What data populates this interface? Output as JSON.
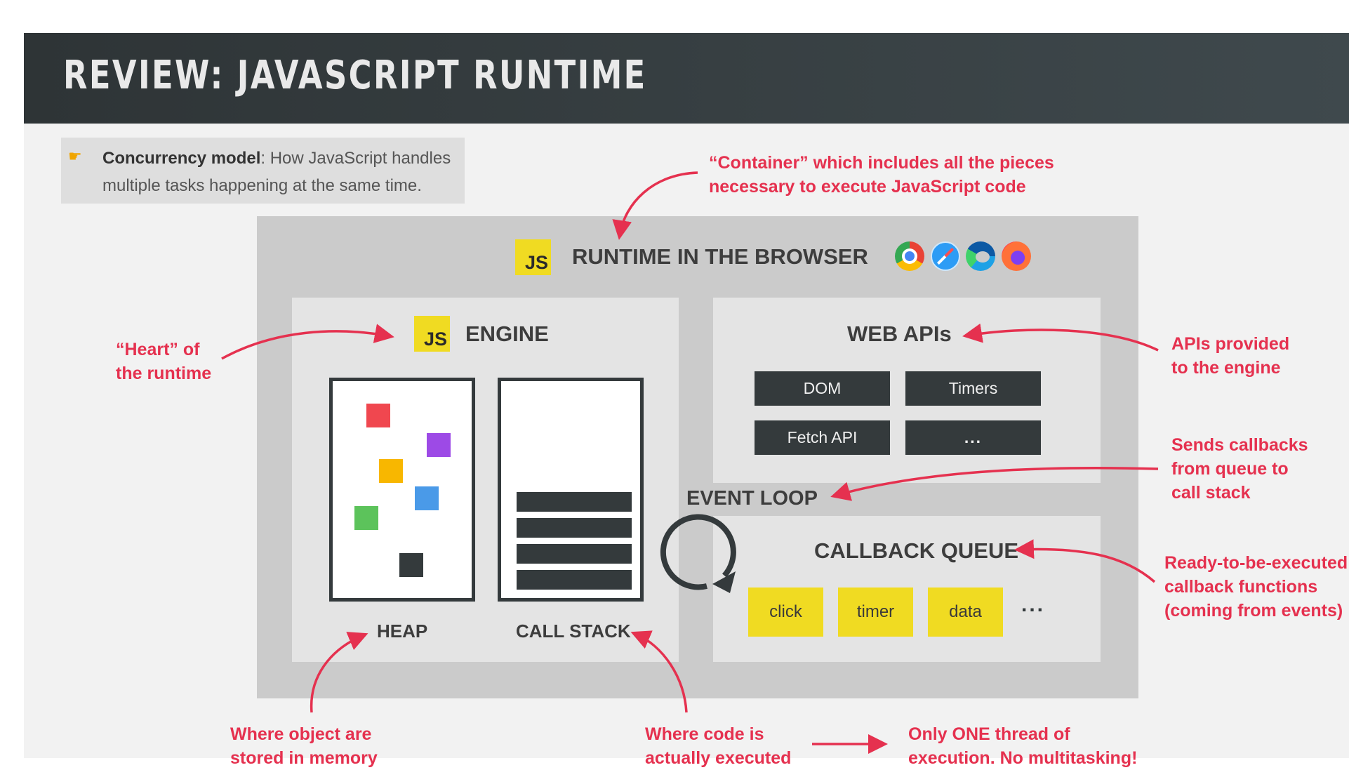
{
  "header": {
    "title": "REVIEW: JAVASCRIPT RUNTIME"
  },
  "concurrency": {
    "term": "Concurrency model",
    "definition": ": How JavaScript handles multiple tasks happening at the same time."
  },
  "runtime": {
    "js_badge": "JS",
    "title": "RUNTIME IN THE BROWSER",
    "browsers": [
      "chrome-icon",
      "safari-icon",
      "edge-icon",
      "firefox-icon"
    ]
  },
  "engine": {
    "js_badge": "JS",
    "title": "ENGINE",
    "heap_label": "HEAP",
    "callstack_label": "CALL STACK"
  },
  "heap_colors": [
    "#f0474f",
    "#9d4ae6",
    "#f8b700",
    "#4a9ae8",
    "#5cc35b",
    "#343a3c"
  ],
  "web_apis": {
    "title": "WEB APIs",
    "items": [
      "DOM",
      "Timers",
      "Fetch API",
      "..."
    ]
  },
  "event_loop": {
    "label": "EVENT LOOP"
  },
  "callback_queue": {
    "title": "CALLBACK QUEUE",
    "items": [
      "click",
      "timer",
      "data"
    ],
    "more": "..."
  },
  "annotations": {
    "container": [
      "“Container” which includes all the pieces",
      "necessary to execute JavaScript code"
    ],
    "heart": [
      "“Heart” of",
      "the runtime"
    ],
    "apis": [
      "APIs provided",
      "to the engine"
    ],
    "sends": [
      "Sends callbacks",
      "from queue to",
      "call stack"
    ],
    "ready": [
      "Ready-to-be-executed",
      "callback functions",
      "(coming from events)"
    ],
    "heap_note": [
      "Where object are",
      "stored in memory"
    ],
    "stack_note": [
      "Where code is",
      "actually executed"
    ],
    "thread_note": [
      "Only ONE thread of",
      "execution. No multitasking!"
    ]
  },
  "colors": {
    "accent_red": "#e5314f",
    "js_yellow": "#f0db22",
    "dark": "#343a3c",
    "header": "#353d40"
  }
}
